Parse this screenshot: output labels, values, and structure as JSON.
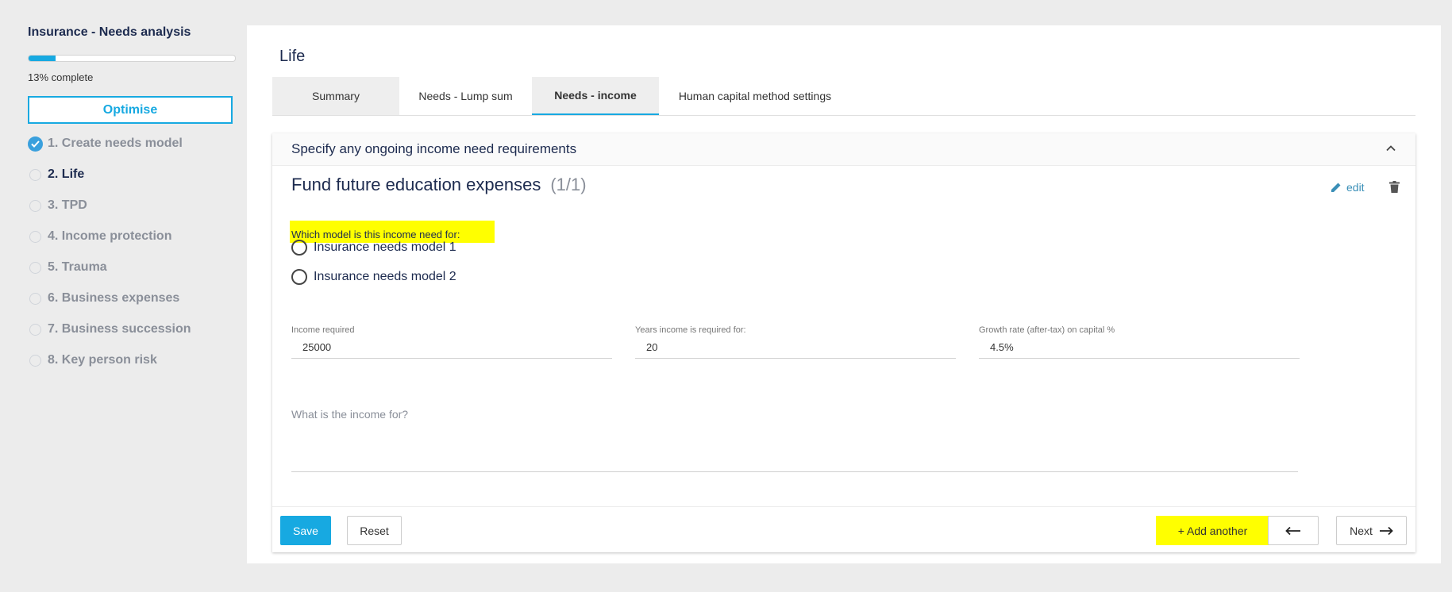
{
  "sidebar": {
    "title": "Insurance - Needs analysis",
    "progress_fraction": 0.13,
    "progress_text": "13% complete",
    "optimise_label": "Optimise",
    "steps": [
      {
        "label": "1. Create needs model",
        "state": "complete"
      },
      {
        "label": "2. Life",
        "state": "active"
      },
      {
        "label": "3. TPD",
        "state": "pending"
      },
      {
        "label": "4. Income protection",
        "state": "pending"
      },
      {
        "label": "5. Trauma",
        "state": "pending"
      },
      {
        "label": "6. Business expenses",
        "state": "pending"
      },
      {
        "label": "7. Business succession",
        "state": "pending"
      },
      {
        "label": "8. Key person risk",
        "state": "pending"
      }
    ]
  },
  "main": {
    "title": "Life",
    "tabs": [
      {
        "label": "Summary"
      },
      {
        "label": "Needs - Lump sum"
      },
      {
        "label": "Needs - income",
        "active": true
      },
      {
        "label": "Human capital method settings"
      }
    ],
    "section": {
      "header": "Specify any ongoing income need requirements",
      "need_title": "Fund future education expenses",
      "need_count": "(1/1)",
      "edit_label": "edit",
      "model_question": "Which model is this income need for:",
      "models": [
        "Insurance needs model 1",
        "Insurance needs model 2"
      ],
      "fields": {
        "income_required": {
          "label": "Income required",
          "value": "25000"
        },
        "years_required": {
          "label": "Years income is required for:",
          "value": "20"
        },
        "growth_rate": {
          "label": "Growth rate (after-tax) on capital %",
          "value": "4.5%"
        }
      },
      "income_for_placeholder": "What is the income for?"
    },
    "footer": {
      "save_label": "Save",
      "reset_label": "Reset",
      "add_another_label": "+ Add another",
      "next_label": "Next"
    }
  },
  "colors": {
    "accent": "#17a9e1",
    "highlight": "#ffff00",
    "heading": "#1d2b4f",
    "muted": "#8a8f99"
  }
}
